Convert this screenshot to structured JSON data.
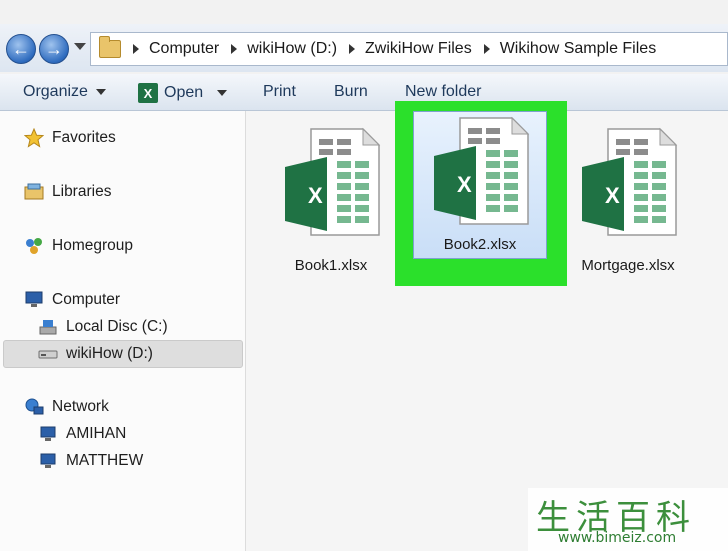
{
  "address": {
    "crumbs": [
      "Computer",
      "wikiHow (D:)",
      "ZwikiHow Files",
      "Wikihow Sample Files"
    ]
  },
  "toolbar": {
    "organize": "Organize",
    "open": "Open",
    "open_icon_letter": "X",
    "print": "Print",
    "burn": "Burn",
    "new_folder": "New folder"
  },
  "sidebar": {
    "favorites": "Favorites",
    "libraries": "Libraries",
    "homegroup": "Homegroup",
    "computer": "Computer",
    "local_disc": "Local Disc (C:)",
    "wikihow_drive": "wikiHow (D:)",
    "network": "Network",
    "amihan": "AMIHAN",
    "matthew": "MATTHEW"
  },
  "files": [
    {
      "name": "Book1.xlsx",
      "letter": "X"
    },
    {
      "name": "Book2.xlsx",
      "letter": "X"
    },
    {
      "name": "Mortgage.xlsx",
      "letter": "X"
    }
  ],
  "colors": {
    "highlight": "#2be02b",
    "excel_green": "#1f7244"
  },
  "watermark": {
    "text": "生活百科",
    "url": "www.bimeiz.com"
  }
}
